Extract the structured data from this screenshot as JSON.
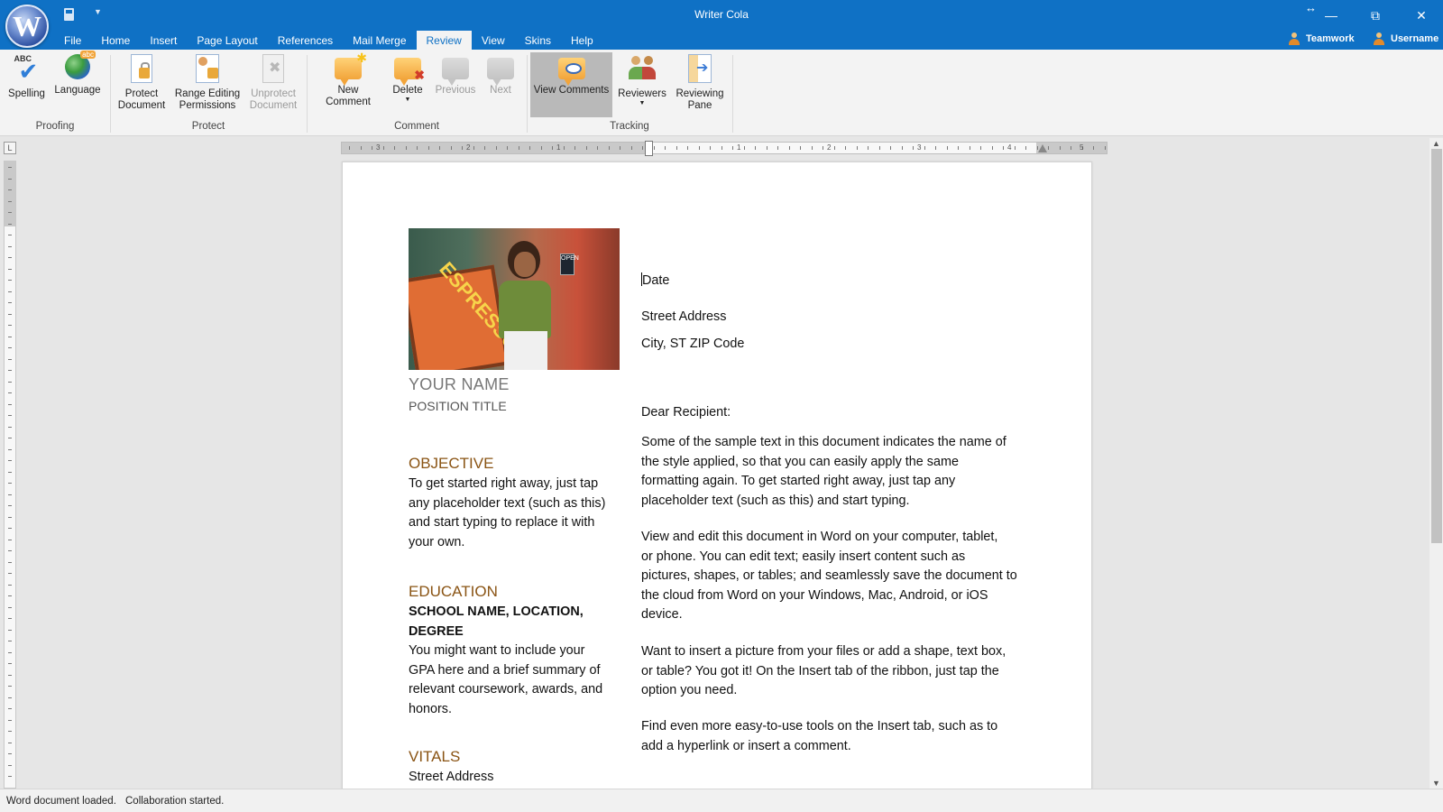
{
  "window": {
    "title": "Writer Cola",
    "min": "—",
    "restore": "⧉",
    "close": "✕",
    "resize_glyph": "↔"
  },
  "menu": {
    "tabs": [
      {
        "label": "File"
      },
      {
        "label": "Home"
      },
      {
        "label": "Insert"
      },
      {
        "label": "Page Layout"
      },
      {
        "label": "References"
      },
      {
        "label": "Mail Merge"
      },
      {
        "label": "Review",
        "active": true
      },
      {
        "label": "View"
      },
      {
        "label": "Skins"
      },
      {
        "label": "Help"
      }
    ],
    "teamwork": "Teamwork",
    "username": "Username"
  },
  "ribbon": {
    "groups": {
      "proofing": "Proofing",
      "protect": "Protect",
      "comment": "Comment",
      "tracking": "Tracking"
    },
    "buttons": {
      "spelling": "Spelling",
      "language": "Language",
      "protect_doc_1": "Protect",
      "protect_doc_2": "Document",
      "range_1": "Range Editing",
      "range_2": "Permissions",
      "unprotect_1": "Unprotect",
      "unprotect_2": "Document",
      "new_comment": "New Comment",
      "delete": "Delete",
      "previous": "Previous",
      "next": "Next",
      "view_comments": "View Comments",
      "reviewers": "Reviewers",
      "reviewing_1": "Reviewing",
      "reviewing_2": "Pane"
    }
  },
  "ruler": {
    "numbers": [
      "3",
      "2",
      "1",
      "1",
      "2",
      "3",
      "4",
      "5"
    ],
    "corner": "L"
  },
  "document": {
    "name": "YOUR NAME",
    "position": "POSITION TITLE",
    "objective_heading": "OBJECTIVE",
    "objective_lines": [
      "To get started right away, just tap",
      "any placeholder text (such as this)",
      "and start typing to replace it with",
      "your own."
    ],
    "education_heading": "EDUCATION",
    "school_lines": [
      "SCHOOL NAME, LOCATION,",
      "DEGREE"
    ],
    "education_lines": [
      "You might want to include your",
      "GPA here and a brief summary of",
      "relevant coursework, awards, and",
      "honors."
    ],
    "vitals_heading": "VITALS",
    "vitals_cut": "Street Address",
    "photo_sign": "ESPRESSO",
    "photo_open": "OPEN",
    "date": "Date",
    "street": "Street Address",
    "city": "City, ST ZIP Code",
    "salutation": "Dear Recipient:",
    "para1": [
      "Some of the sample text in this document indicates the name of",
      "the style applied, so that you can easily apply the same",
      "formatting again. To get started right away, just tap any",
      "placeholder text (such as this) and start typing."
    ],
    "para2": [
      "View and edit this document in Word on your computer, tablet,",
      "or phone. You can edit text; easily insert content such as",
      "pictures, shapes, or tables; and seamlessly save the document to",
      "the cloud from Word on your Windows, Mac, Android, or iOS",
      "device."
    ],
    "para3": [
      "Want to insert a picture from your files or add a shape, text box,",
      "or table? You got it! On the Insert tab of the ribbon, just tap the",
      "option you need."
    ],
    "para4": [
      "Find even more easy-to-use tools on the Insert tab, such as to",
      "add a hyperlink or insert a comment."
    ]
  },
  "status": {
    "loaded": "Word document loaded.",
    "collab": "Collaboration started."
  }
}
